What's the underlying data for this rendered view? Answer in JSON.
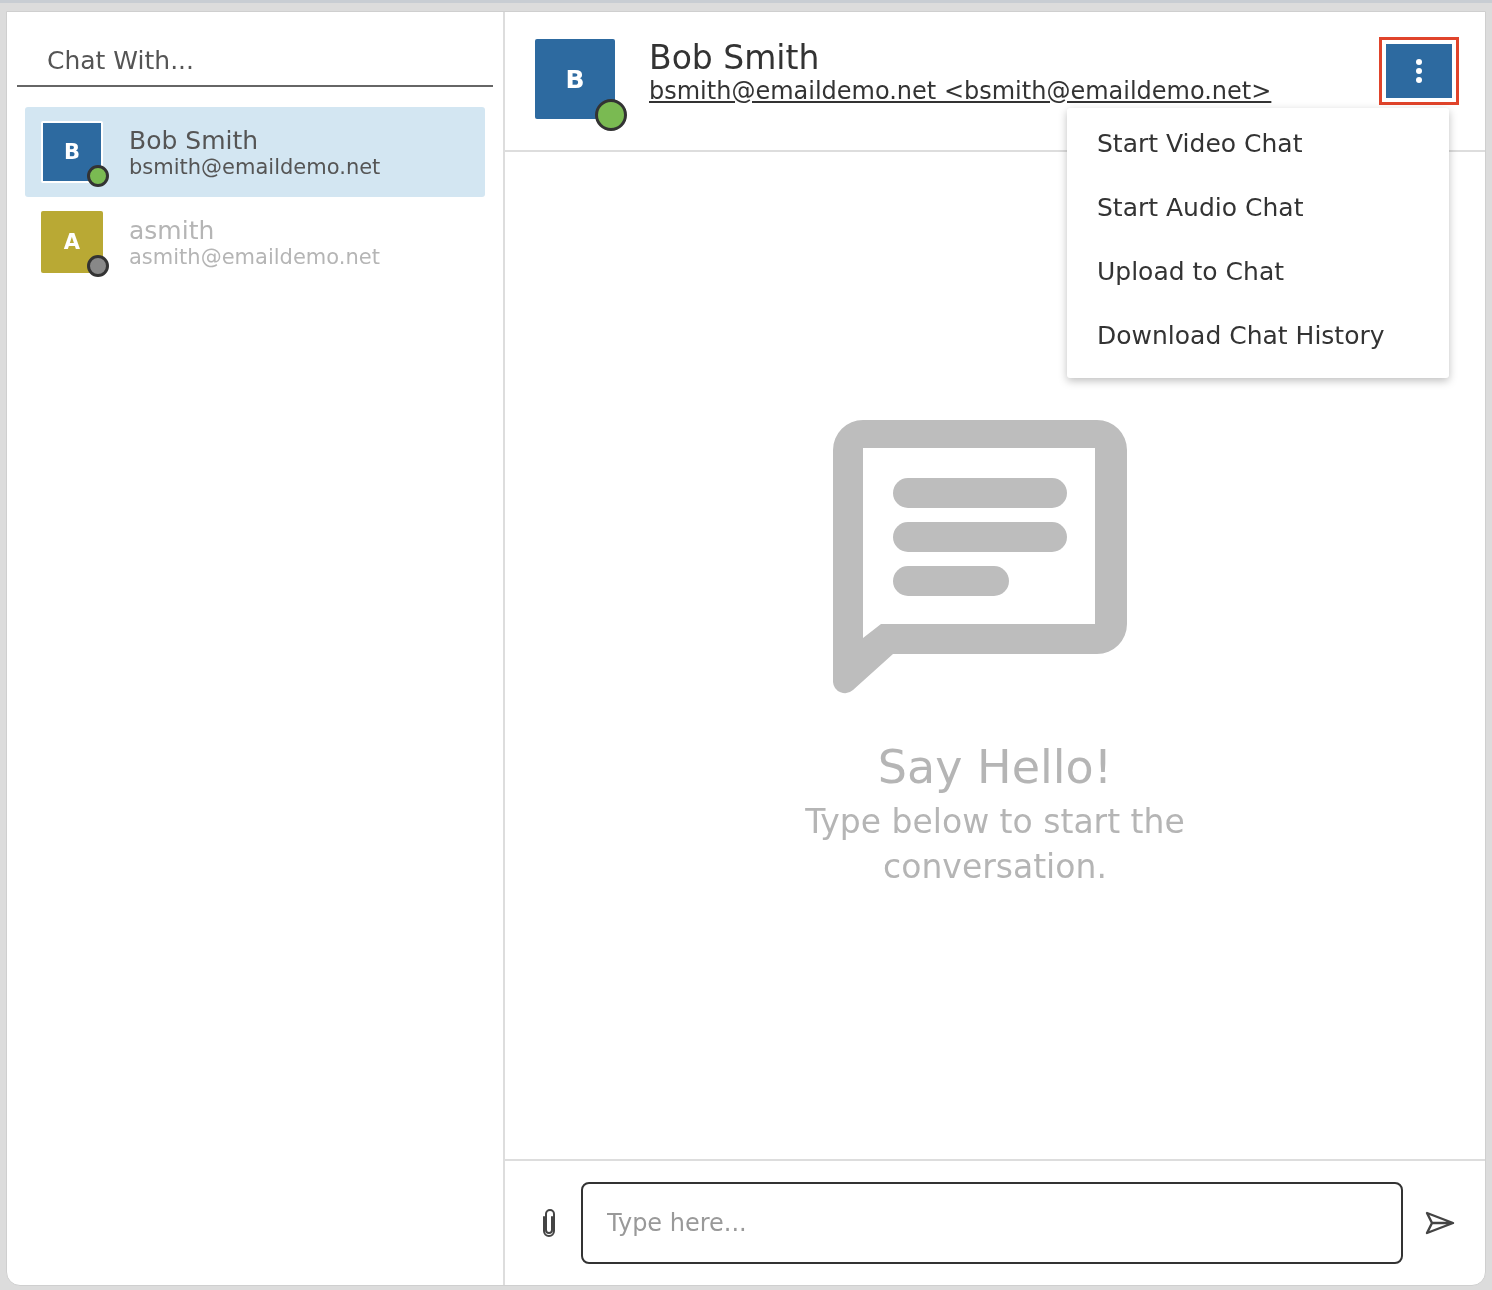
{
  "sidebar": {
    "title": "Chat With...",
    "contacts": [
      {
        "initial": "B",
        "name": "Bob Smith",
        "email": "bsmith@emaildemo.net",
        "color": "#2d6aa0",
        "online": true,
        "selected": true
      },
      {
        "initial": "A",
        "name": "asmith",
        "email": "asmith@emaildemo.net",
        "color": "#b9a934",
        "online": false,
        "selected": false
      }
    ]
  },
  "header": {
    "initial": "B",
    "name": "Bob Smith",
    "email": "bsmith@emaildemo.net <bsmith@emaildemo.net>",
    "color": "#2d6aa0",
    "online": true
  },
  "menu": {
    "open": true,
    "items": [
      "Start Video Chat",
      "Start Audio Chat",
      "Upload to Chat",
      "Download Chat History"
    ]
  },
  "empty_state": {
    "title": "Say Hello!",
    "subtitle": "Type below to start the conversation."
  },
  "composer": {
    "placeholder": "Type here..."
  }
}
